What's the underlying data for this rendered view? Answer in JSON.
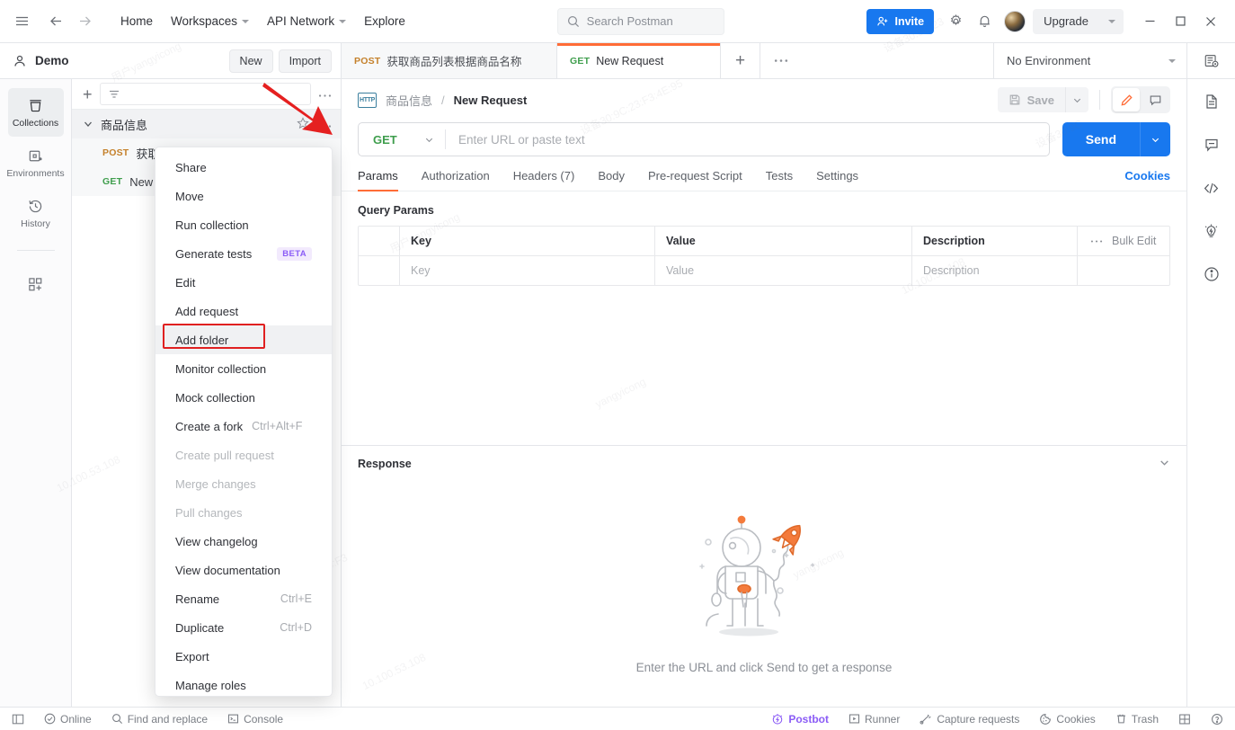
{
  "topbar": {
    "hamburger_icon": "menu-icon",
    "back_icon": "arrow-left-icon",
    "forward_icon": "arrow-right-icon",
    "links": [
      {
        "label": "Home",
        "has_caret": false
      },
      {
        "label": "Workspaces",
        "has_caret": true
      },
      {
        "label": "API Network",
        "has_caret": true
      },
      {
        "label": "Explore",
        "has_caret": false
      }
    ],
    "search_placeholder": "Search Postman",
    "invite_label": "Invite",
    "settings_icon": "gear-icon",
    "notifications_icon": "bell-icon",
    "upgrade_label": "Upgrade",
    "minimize_icon": "minimize-icon",
    "maximize_icon": "maximize-icon",
    "close_icon": "close-icon"
  },
  "workspace": {
    "name": "Demo",
    "new_label": "New",
    "import_label": "Import"
  },
  "tabs": [
    {
      "method": "POST",
      "label": "获取商品列表根据商品名称",
      "active": false
    },
    {
      "method": "GET",
      "label": "New Request",
      "active": true
    }
  ],
  "tab_add_icon": "plus-icon",
  "tab_more_icon": "more-horizontal-icon",
  "environment": {
    "selected": "No Environment",
    "chevron_icon": "chevron-down-icon"
  },
  "rail_top_icon": "environment-quick-look-icon",
  "sidebar_rail": [
    {
      "label": "Collections",
      "icon": "collections-icon",
      "active": true
    },
    {
      "label": "Environments",
      "icon": "environments-icon",
      "active": false
    },
    {
      "label": "History",
      "icon": "history-icon",
      "active": false
    },
    {
      "label": "",
      "icon": "add-apps-icon",
      "active": false
    }
  ],
  "collections_panel": {
    "add_icon": "plus-icon",
    "filter_icon": "filter-icon",
    "filter_placeholder": "",
    "more_icon": "more-horizontal-icon",
    "collection": {
      "name": "商品信息",
      "expanded": true,
      "star_icon": "star-icon",
      "more_icon": "more-horizontal-icon"
    },
    "requests": [
      {
        "method": "POST",
        "label": "获取商品列表"
      },
      {
        "method": "GET",
        "label": "New Request"
      }
    ]
  },
  "context_menu": {
    "items": [
      {
        "label": "Share",
        "shortcut": "",
        "disabled": false,
        "badge": "",
        "highlighted": false
      },
      {
        "label": "Move",
        "shortcut": "",
        "disabled": false,
        "badge": "",
        "highlighted": false
      },
      {
        "label": "Run collection",
        "shortcut": "",
        "disabled": false,
        "badge": "",
        "highlighted": false
      },
      {
        "label": "Generate tests",
        "shortcut": "",
        "disabled": false,
        "badge": "BETA",
        "highlighted": false
      },
      {
        "label": "Edit",
        "shortcut": "",
        "disabled": false,
        "badge": "",
        "highlighted": false
      },
      {
        "label": "Add request",
        "shortcut": "",
        "disabled": false,
        "badge": "",
        "highlighted": false
      },
      {
        "label": "Add folder",
        "shortcut": "",
        "disabled": false,
        "badge": "",
        "highlighted": true
      },
      {
        "label": "Monitor collection",
        "shortcut": "",
        "disabled": false,
        "badge": "",
        "highlighted": false
      },
      {
        "label": "Mock collection",
        "shortcut": "",
        "disabled": false,
        "badge": "",
        "highlighted": false
      },
      {
        "label": "Create a fork",
        "shortcut": "Ctrl+Alt+F",
        "disabled": false,
        "badge": "",
        "highlighted": false
      },
      {
        "label": "Create pull request",
        "shortcut": "",
        "disabled": true,
        "badge": "",
        "highlighted": false
      },
      {
        "label": "Merge changes",
        "shortcut": "",
        "disabled": true,
        "badge": "",
        "highlighted": false
      },
      {
        "label": "Pull changes",
        "shortcut": "",
        "disabled": true,
        "badge": "",
        "highlighted": false
      },
      {
        "label": "View changelog",
        "shortcut": "",
        "disabled": false,
        "badge": "",
        "highlighted": false
      },
      {
        "label": "View documentation",
        "shortcut": "",
        "disabled": false,
        "badge": "",
        "highlighted": false
      },
      {
        "label": "Rename",
        "shortcut": "Ctrl+E",
        "disabled": false,
        "badge": "",
        "highlighted": false
      },
      {
        "label": "Duplicate",
        "shortcut": "Ctrl+D",
        "disabled": false,
        "badge": "",
        "highlighted": false
      },
      {
        "label": "Export",
        "shortcut": "",
        "disabled": false,
        "badge": "",
        "highlighted": false
      },
      {
        "label": "Manage roles",
        "shortcut": "",
        "disabled": false,
        "badge": "",
        "highlighted": false
      }
    ]
  },
  "request": {
    "protocol_badge": "HTTP",
    "breadcrumb_collection": "商品信息",
    "breadcrumb_separator": "/",
    "breadcrumb_current": "New Request",
    "save_label": "Save",
    "save_icon": "save-icon",
    "pencil_icon": "pencil-icon",
    "comment_icon": "comment-icon",
    "method": "GET",
    "url_placeholder": "Enter URL or paste text",
    "url_value": "",
    "send_label": "Send",
    "tabs": [
      {
        "label": "Params",
        "active": true
      },
      {
        "label": "Authorization",
        "active": false
      },
      {
        "label": "Headers (7)",
        "active": false
      },
      {
        "label": "Body",
        "active": false
      },
      {
        "label": "Pre-request Script",
        "active": false
      },
      {
        "label": "Tests",
        "active": false
      },
      {
        "label": "Settings",
        "active": false
      }
    ],
    "cookies_label": "Cookies"
  },
  "query_params": {
    "title": "Query Params",
    "columns": [
      "Key",
      "Value",
      "Description"
    ],
    "bulk_edit_label": "Bulk Edit",
    "bulk_more_icon": "more-horizontal-icon",
    "rows": [
      {
        "key": "Key",
        "value": "Value",
        "description": "Description"
      }
    ]
  },
  "response": {
    "title": "Response",
    "collapse_icon": "chevron-down-icon",
    "empty_hint": "Enter the URL and click Send to get a response",
    "illustration": "astronaut-rocket-illustration"
  },
  "right_rail": [
    {
      "icon": "documentation-icon"
    },
    {
      "icon": "comments-icon"
    },
    {
      "icon": "code-snippet-icon"
    },
    {
      "icon": "postbot-bulb-icon"
    },
    {
      "icon": "info-icon"
    }
  ],
  "statusbar": {
    "left": [
      {
        "label": "",
        "icon": "sidebar-toggle-icon"
      },
      {
        "label": "Online",
        "icon": "check-circle-icon"
      },
      {
        "label": "Find and replace",
        "icon": "search-icon"
      },
      {
        "label": "Console",
        "icon": "console-icon"
      }
    ],
    "right": [
      {
        "label": "Postbot",
        "icon": "postbot-icon"
      },
      {
        "label": "Runner",
        "icon": "runner-icon"
      },
      {
        "label": "Capture requests",
        "icon": "capture-icon"
      },
      {
        "label": "Cookies",
        "icon": "cookie-icon"
      },
      {
        "label": "Trash",
        "icon": "trash-icon"
      },
      {
        "label": "",
        "icon": "layout-icon"
      },
      {
        "label": "",
        "icon": "help-icon"
      }
    ]
  },
  "colors": {
    "accent_orange": "#ff6c37",
    "primary_blue": "#1878ef",
    "get_green": "#3f9e4d",
    "post_orange": "#c4802a",
    "highlight_red": "#e02020",
    "postbot_purple": "#8b5cf6"
  },
  "annotations": {
    "arrow": "red-arrow-pointing-to-collection-more-button",
    "box": "red-box-around-add-folder"
  }
}
